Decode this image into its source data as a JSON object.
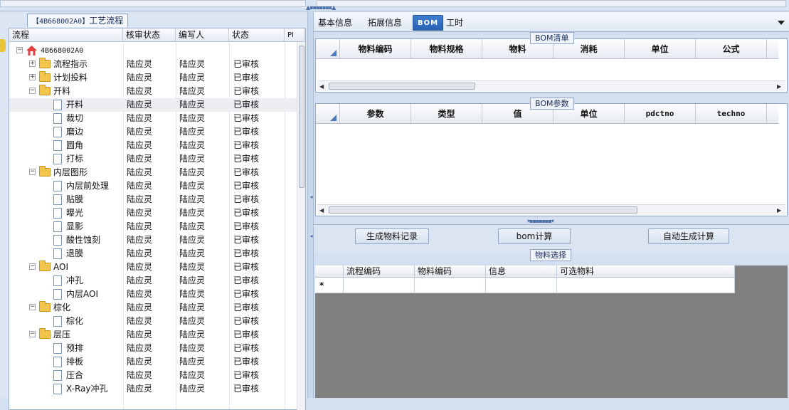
{
  "left": {
    "panel_title_code": "【4B668002A0】",
    "panel_title_text": "工艺流程",
    "columns": [
      "流程",
      "核审状态",
      "编写人",
      "状态",
      "PI"
    ],
    "rows": [
      {
        "label": "4B668002A0",
        "icon": "home-icon",
        "level": 0,
        "expand": "−",
        "review": "",
        "writer": "",
        "status": "",
        "sel": false
      },
      {
        "label": "流程指示",
        "icon": "folder-icon",
        "level": 1,
        "expand": "+",
        "review": "陆应灵",
        "writer": "陆应灵",
        "status": "已审核",
        "sel": false
      },
      {
        "label": "计划投料",
        "icon": "folder-icon",
        "level": 1,
        "expand": "+",
        "review": "陆应灵",
        "writer": "陆应灵",
        "status": "已审核",
        "sel": false
      },
      {
        "label": "开料",
        "icon": "folder-icon",
        "level": 1,
        "expand": "−",
        "review": "陆应灵",
        "writer": "陆应灵",
        "status": "已审核",
        "sel": false
      },
      {
        "label": "开料",
        "icon": "document-icon",
        "level": 2,
        "expand": "",
        "review": "陆应灵",
        "writer": "陆应灵",
        "status": "已审核",
        "sel": true
      },
      {
        "label": "裁切",
        "icon": "document-icon",
        "level": 2,
        "expand": "",
        "review": "陆应灵",
        "writer": "陆应灵",
        "status": "已审核",
        "sel": false
      },
      {
        "label": "磨边",
        "icon": "document-icon",
        "level": 2,
        "expand": "",
        "review": "陆应灵",
        "writer": "陆应灵",
        "status": "已审核",
        "sel": false
      },
      {
        "label": "圆角",
        "icon": "document-icon",
        "level": 2,
        "expand": "",
        "review": "陆应灵",
        "writer": "陆应灵",
        "status": "已审核",
        "sel": false
      },
      {
        "label": "打标",
        "icon": "document-icon",
        "level": 2,
        "expand": "",
        "review": "陆应灵",
        "writer": "陆应灵",
        "status": "已审核",
        "sel": false
      },
      {
        "label": "内层图形",
        "icon": "folder-icon",
        "level": 1,
        "expand": "−",
        "review": "陆应灵",
        "writer": "陆应灵",
        "status": "已审核",
        "sel": false
      },
      {
        "label": "内层前处理",
        "icon": "document-icon",
        "level": 2,
        "expand": "",
        "review": "陆应灵",
        "writer": "陆应灵",
        "status": "已审核",
        "sel": false
      },
      {
        "label": "贴膜",
        "icon": "document-icon",
        "level": 2,
        "expand": "",
        "review": "陆应灵",
        "writer": "陆应灵",
        "status": "已审核",
        "sel": false
      },
      {
        "label": "曝光",
        "icon": "document-icon",
        "level": 2,
        "expand": "",
        "review": "陆应灵",
        "writer": "陆应灵",
        "status": "已审核",
        "sel": false
      },
      {
        "label": "显影",
        "icon": "document-icon",
        "level": 2,
        "expand": "",
        "review": "陆应灵",
        "writer": "陆应灵",
        "status": "已审核",
        "sel": false
      },
      {
        "label": "酸性蚀刻",
        "icon": "document-icon",
        "level": 2,
        "expand": "",
        "review": "陆应灵",
        "writer": "陆应灵",
        "status": "已审核",
        "sel": false
      },
      {
        "label": "退膜",
        "icon": "document-icon",
        "level": 2,
        "expand": "",
        "review": "陆应灵",
        "writer": "陆应灵",
        "status": "已审核",
        "sel": false
      },
      {
        "label": "AOI",
        "icon": "folder-icon",
        "level": 1,
        "expand": "−",
        "review": "陆应灵",
        "writer": "陆应灵",
        "status": "已审核",
        "sel": false
      },
      {
        "label": "冲孔",
        "icon": "document-icon",
        "level": 2,
        "expand": "",
        "review": "陆应灵",
        "writer": "陆应灵",
        "status": "已审核",
        "sel": false
      },
      {
        "label": "内层AOI",
        "icon": "document-icon",
        "level": 2,
        "expand": "",
        "review": "陆应灵",
        "writer": "陆应灵",
        "status": "已审核",
        "sel": false
      },
      {
        "label": "棕化",
        "icon": "folder-icon",
        "level": 1,
        "expand": "−",
        "review": "陆应灵",
        "writer": "陆应灵",
        "status": "已审核",
        "sel": false
      },
      {
        "label": "棕化",
        "icon": "document-icon",
        "level": 2,
        "expand": "",
        "review": "陆应灵",
        "writer": "陆应灵",
        "status": "已审核",
        "sel": false
      },
      {
        "label": "层压",
        "icon": "folder-icon",
        "level": 1,
        "expand": "−",
        "review": "陆应灵",
        "writer": "陆应灵",
        "status": "已审核",
        "sel": false
      },
      {
        "label": "预排",
        "icon": "document-icon",
        "level": 2,
        "expand": "",
        "review": "陆应灵",
        "writer": "陆应灵",
        "status": "已审核",
        "sel": false
      },
      {
        "label": "排板",
        "icon": "document-icon",
        "level": 2,
        "expand": "",
        "review": "陆应灵",
        "writer": "陆应灵",
        "status": "已审核",
        "sel": false
      },
      {
        "label": "压合",
        "icon": "document-icon",
        "level": 2,
        "expand": "",
        "review": "陆应灵",
        "writer": "陆应灵",
        "status": "已审核",
        "sel": false
      },
      {
        "label": "X-Ray冲孔",
        "icon": "document-icon",
        "level": 2,
        "expand": "",
        "review": "陆应灵",
        "writer": "陆应灵",
        "status": "已审核",
        "sel": false
      }
    ]
  },
  "right": {
    "tabs": [
      {
        "label": "基本信息",
        "active": false
      },
      {
        "label": "拓展信息",
        "active": false
      },
      {
        "label": "BOM",
        "active": true
      },
      {
        "label": "工时",
        "active": false
      }
    ],
    "bom_list": {
      "title": "BOM清单",
      "columns": [
        "物料编码",
        "物料规格",
        "物料",
        "消耗",
        "单位",
        "公式"
      ]
    },
    "bom_params": {
      "title": "BOM参数",
      "columns": [
        "参数",
        "类型",
        "值",
        "单位",
        "pdctno",
        "techno"
      ]
    },
    "buttons": {
      "generate_record": "生成物料记录",
      "bom_calc": "bom计算",
      "auto_calc": "自动生成计算"
    },
    "material_select": {
      "title": "物料选择",
      "columns": [
        "流程编码",
        "物料编码",
        "信息",
        "可选物料"
      ],
      "new_row_marker": "*"
    }
  },
  "colors": {
    "accent": "#2a62b2",
    "panel_bg": "#d4e0ef",
    "grid_empty": "#808080"
  }
}
